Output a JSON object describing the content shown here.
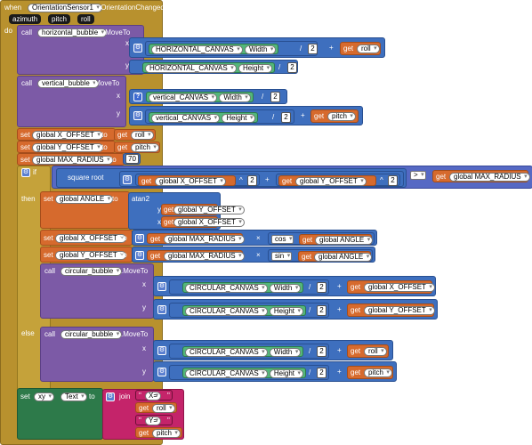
{
  "event": {
    "when": "when",
    "component": "OrientationSensor1",
    "event_name": ".OrientationChanged",
    "do": "do",
    "params": [
      "azimuth",
      "pitch",
      "roll"
    ]
  },
  "kw": {
    "call": "call",
    "moveto": ".MoveTo",
    "x": "x",
    "y": "y",
    "set": "set",
    "to": "to",
    "get": "get",
    "if": "if",
    "then": "then",
    "else": "else",
    "sqrt": "square root",
    "atan2": "atan2",
    "cos": "cos",
    "sin": "sin",
    "join": "join",
    "div": "/",
    "plus": "+",
    "pow": "^",
    "minus": "-",
    "times": "×",
    "gt": ">"
  },
  "comp": {
    "hb": "horizontal_bubble",
    "vb": "vertical_bubble",
    "cb": "circular_bubble",
    "hcanvas": "HORIZONTAL_CANVAS",
    "vcanvas": "vertical_CANVAS",
    "ccanvas": "CIRCULAR_CANVAS",
    "xy": "xy"
  },
  "prop": {
    "width": "Width",
    "height": "Height",
    "text": "Text"
  },
  "vars": {
    "roll": "roll",
    "pitch": "pitch",
    "xoff": "global X_OFFSET",
    "yoff": "global Y_OFFSET",
    "maxr": "global MAX_RADIUS",
    "angle": "global ANGLE"
  },
  "nums": {
    "two": "2",
    "seventy": "70"
  },
  "strings": {
    "xeq": "X=",
    "yeq": "Y="
  },
  "colors": {
    "event": "#b8912e",
    "procedure": "#7c5aa6",
    "variable": "#d66a2d",
    "math": "#3e6fbe",
    "component": "#2d7a4a",
    "text": "#c4246a"
  }
}
